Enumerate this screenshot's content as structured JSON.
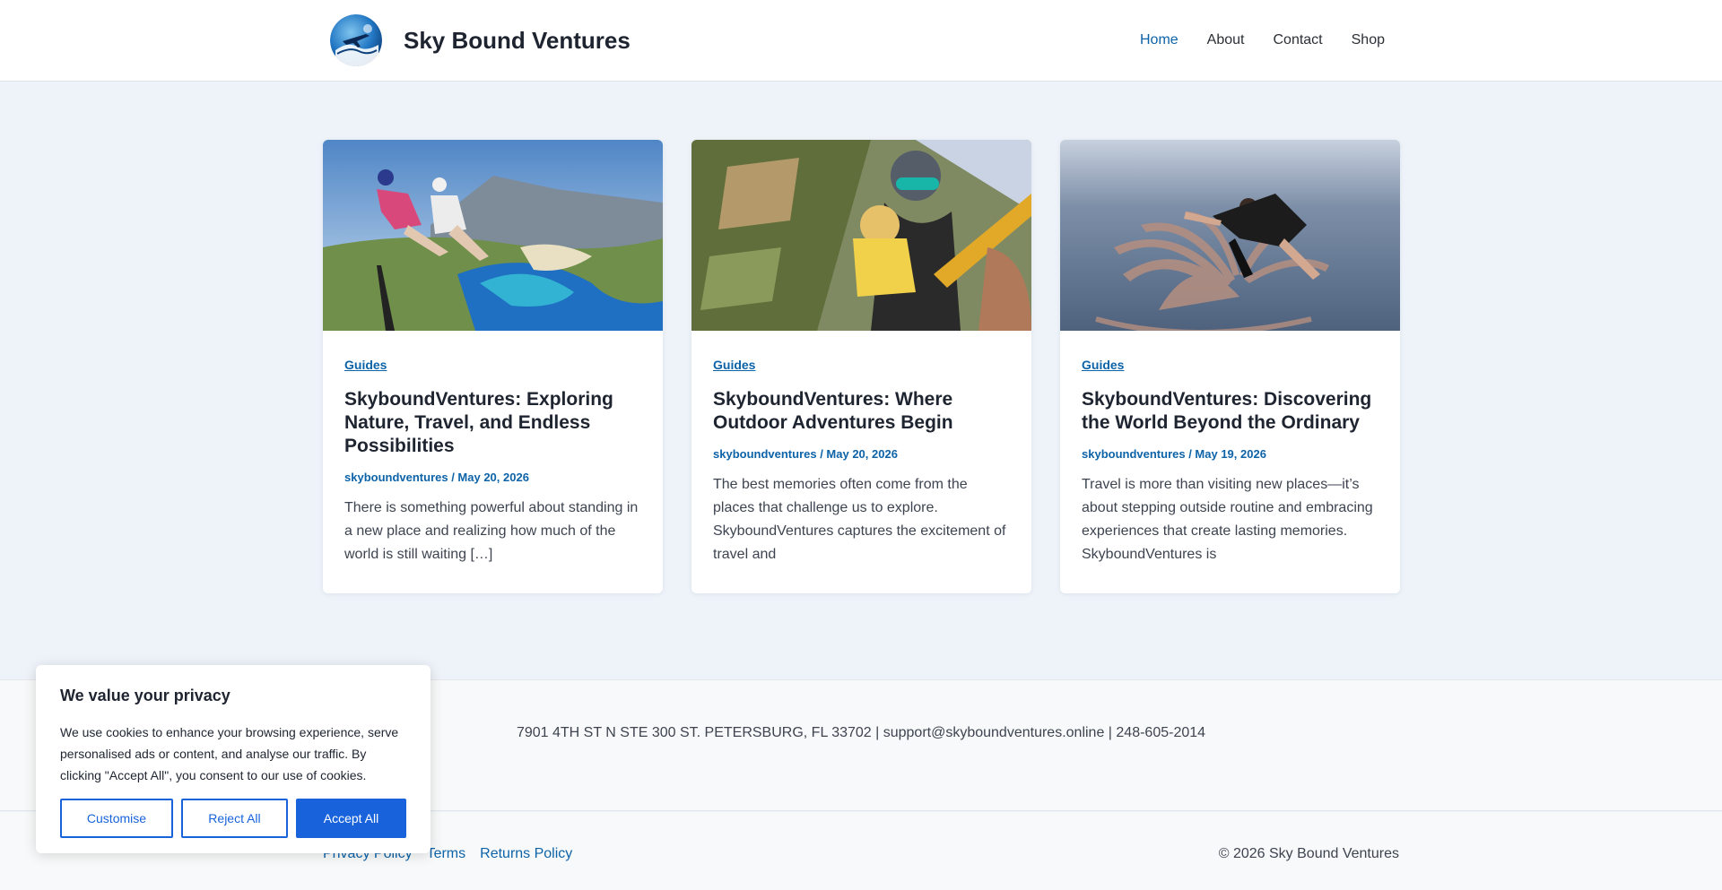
{
  "header": {
    "site_title": "Sky Bound Ventures",
    "nav": [
      {
        "label": "Home",
        "active": true
      },
      {
        "label": "About",
        "active": false
      },
      {
        "label": "Contact",
        "active": false
      },
      {
        "label": "Shop",
        "active": false
      }
    ]
  },
  "posts": [
    {
      "category": "Guides",
      "title": "SkyboundVentures: Exploring Nature, Travel, and Endless Possibilities",
      "author": "skyboundventures",
      "date": "May 20, 2026",
      "meta": "skyboundventures / May 20, 2026",
      "excerpt": "There is something powerful about standing in a new place and realizing how much of the world is still waiting […]"
    },
    {
      "category": "Guides",
      "title": "SkyboundVentures: Where Outdoor Adventures Begin",
      "author": "skyboundventures",
      "date": "May 20, 2026",
      "meta": "skyboundventures / May 20, 2026",
      "excerpt": "The best memories often come from the places that challenge us to explore. SkyboundVentures captures the excitement of travel and"
    },
    {
      "category": "Guides",
      "title": "SkyboundVentures: Discovering the World Beyond the Ordinary",
      "author": "skyboundventures",
      "date": "May 19, 2026",
      "meta": "skyboundventures / May 19, 2026",
      "excerpt": "Travel is more than visiting new places—it’s about stepping outside routine and embracing experiences that create lasting memories. SkyboundVentures is"
    }
  ],
  "footer": {
    "contact": "7901 4TH ST N STE 300 ST. PETERSBURG, FL 33702 | support@skyboundventures.online | 248-605-2014",
    "links": [
      "Privacy Policy",
      "Terms",
      "Returns Policy"
    ],
    "copyright": "© 2026 Sky Bound Ventures"
  },
  "cookie": {
    "title": "We value your privacy",
    "text": "We use cookies to enhance your browsing experience, serve personalised ads or content, and analyse our traffic. By clicking \"Accept All\", you consent to our use of cookies.",
    "customise_label": "Customise",
    "reject_label": "Reject All",
    "accept_label": "Accept All"
  },
  "colors": {
    "accent": "#0d63a8",
    "button_blue": "#1863dc",
    "page_bg": "#eef3f9"
  },
  "icons": [
    "logo-airplane-icon"
  ]
}
